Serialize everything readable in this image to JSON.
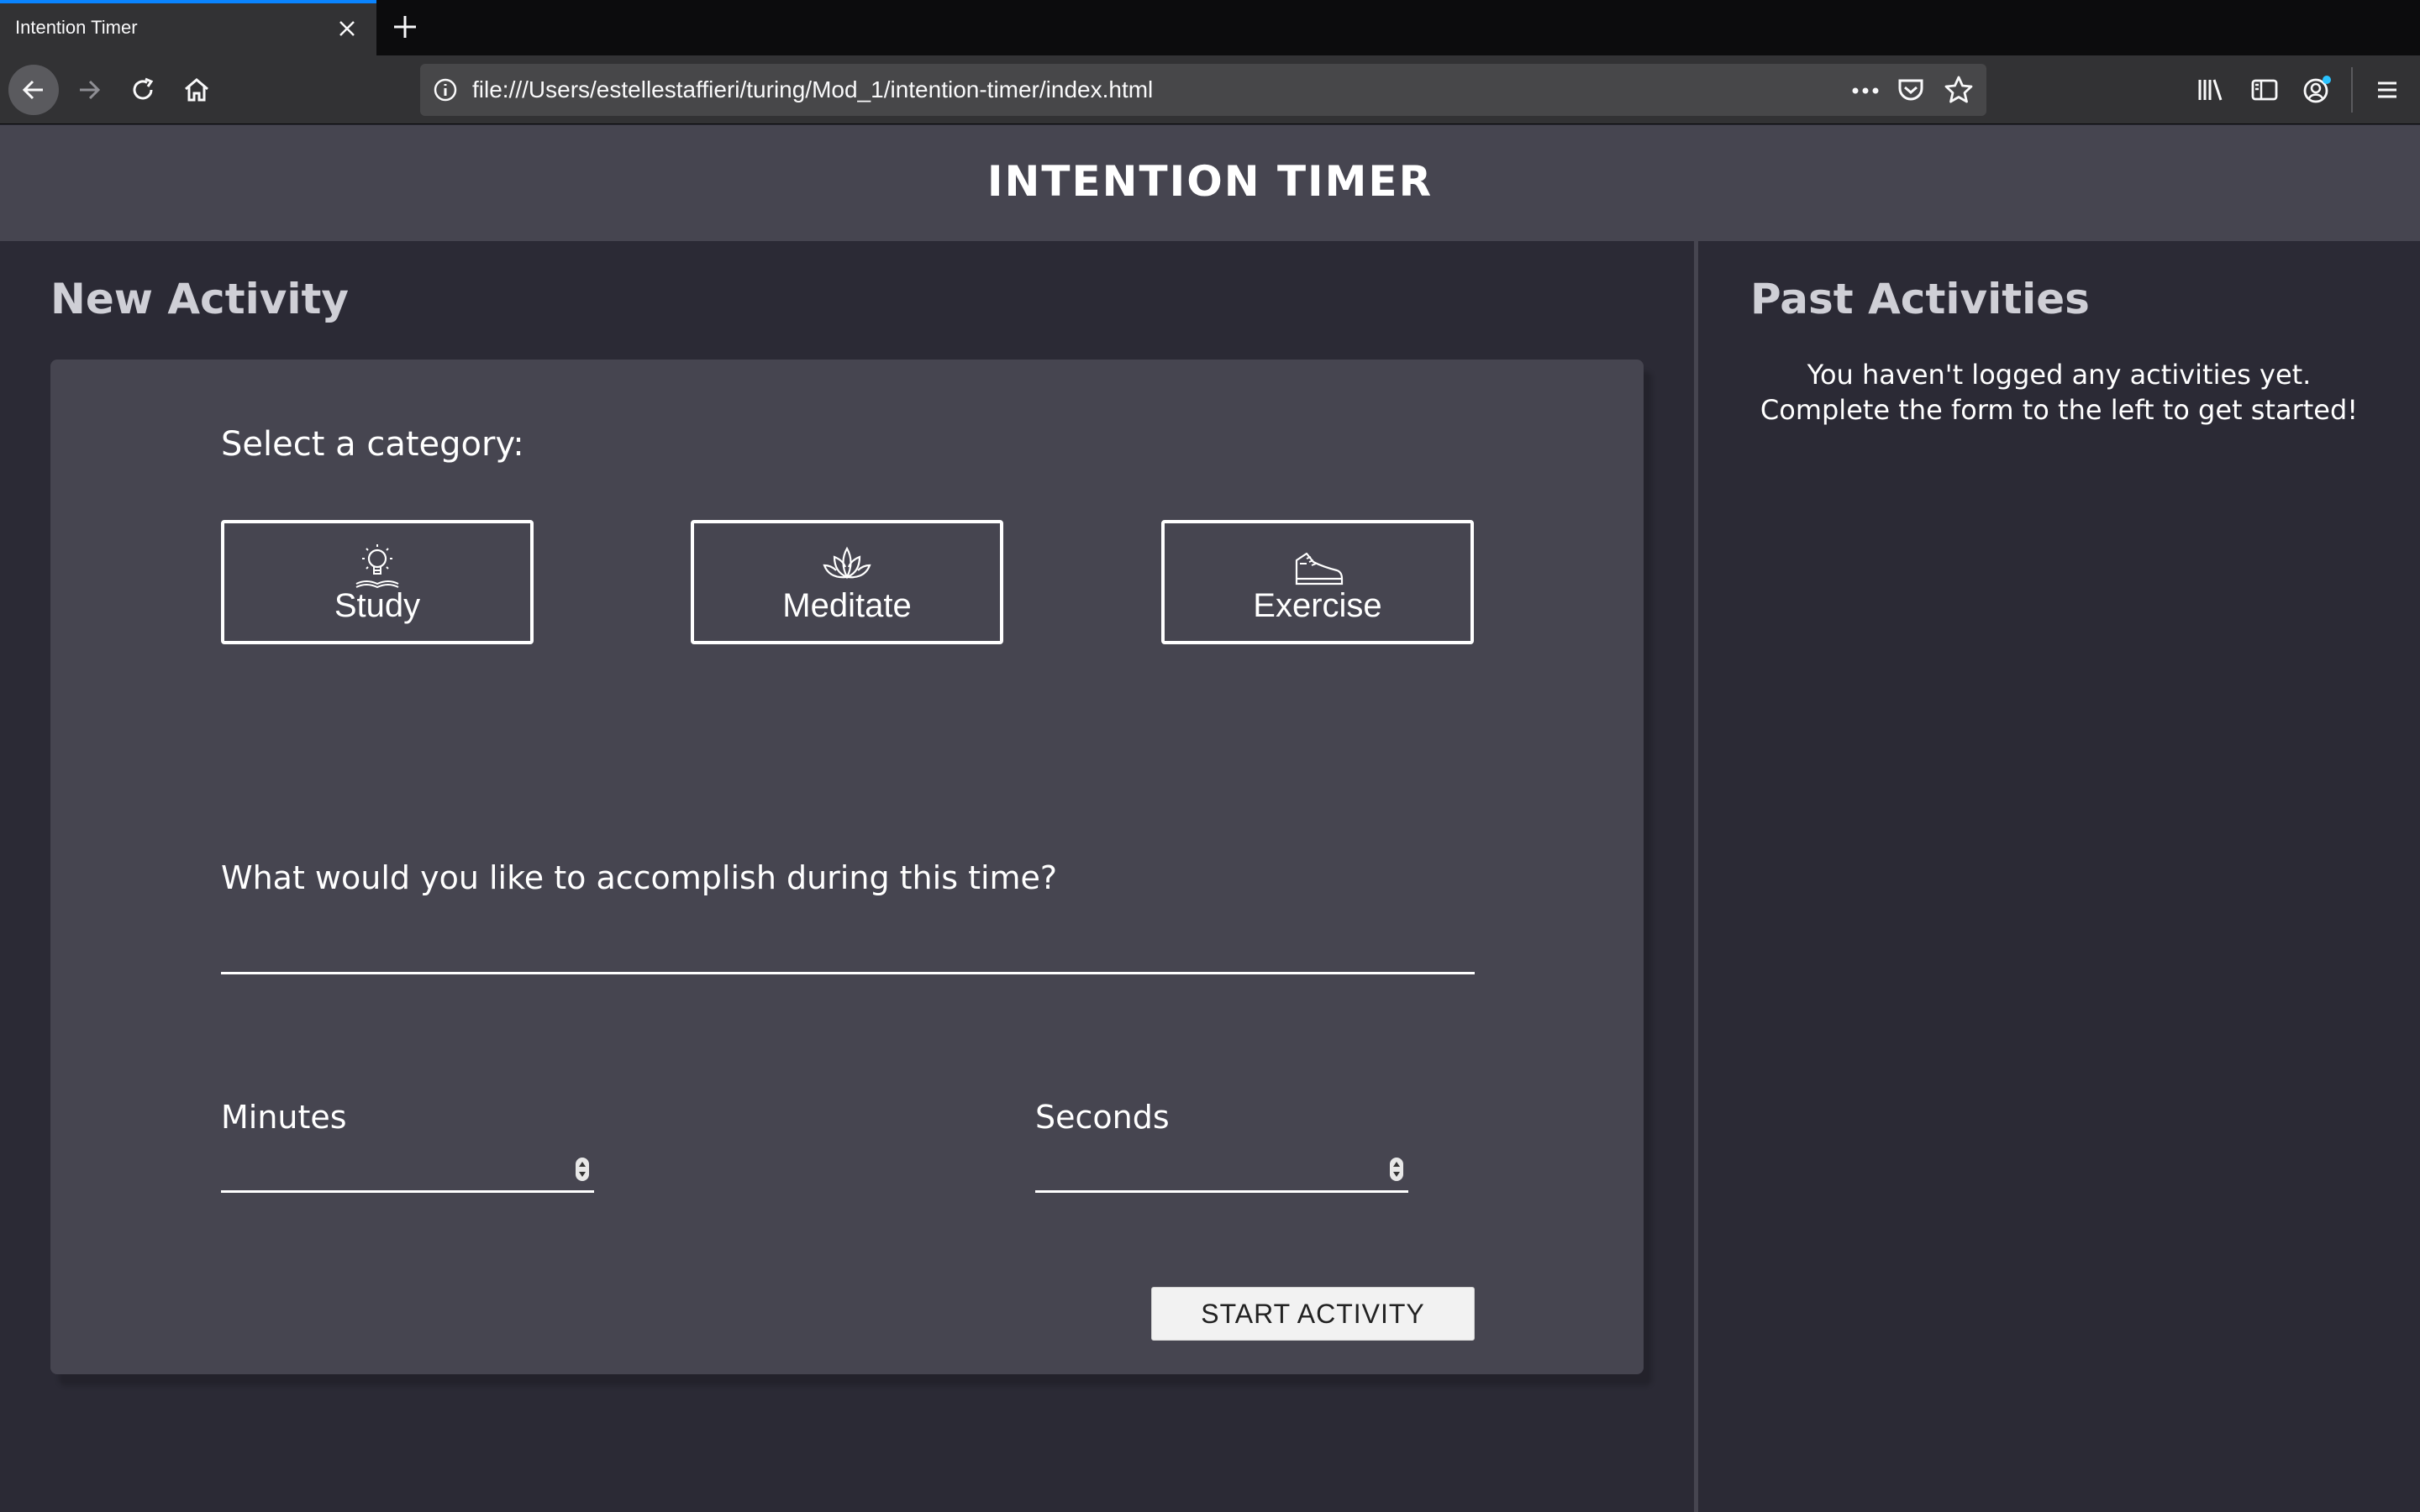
{
  "browser": {
    "tab_title": "Intention Timer",
    "url": "file:///Users/estellestaffieri/turing/Mod_1/intention-timer/index.html"
  },
  "icons": {
    "tab_close": "close-icon",
    "new_tab": "plus-icon",
    "back": "arrow-left-icon",
    "forward": "arrow-right-icon",
    "reload": "reload-icon",
    "home": "home-icon",
    "site_info": "info-icon",
    "page_actions": "ellipsis-icon",
    "pocket": "pocket-icon",
    "bookmark": "star-icon",
    "library": "library-icon",
    "sidebar": "sidebar-icon",
    "account": "account-icon",
    "menu": "hamburger-icon",
    "study": "lightbulb-icon",
    "meditate": "lotus-icon",
    "exercise": "sneaker-icon"
  },
  "app": {
    "title": "INTENTION TIMER"
  },
  "new_activity": {
    "heading": "New Activity",
    "category_prompt": "Select a category:",
    "categories": [
      {
        "label": "Study"
      },
      {
        "label": "Meditate"
      },
      {
        "label": "Exercise"
      }
    ],
    "goal_prompt": "What would you like to accomplish during this time?",
    "goal_value": "",
    "minutes_label": "Minutes",
    "seconds_label": "Seconds",
    "start_button": "START ACTIVITY"
  },
  "past_activities": {
    "heading": "Past Activities",
    "empty_line1": "You haven't logged any activities yet.",
    "empty_line2": "Complete the form to the left to get started!"
  },
  "colors": {
    "accent_tab": "#0a84ff",
    "header_bg": "#464550",
    "page_bg": "#2b2a35",
    "card_bg": "#464550"
  }
}
